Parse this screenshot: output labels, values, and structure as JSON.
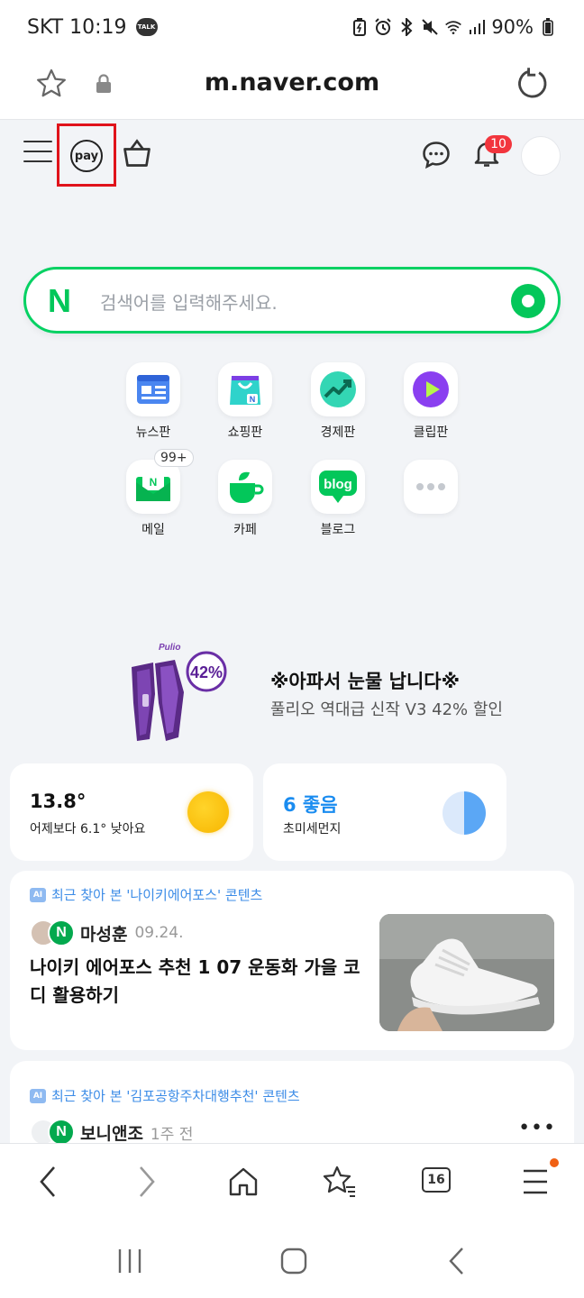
{
  "status_bar": {
    "carrier_time": "SKT 10:19",
    "talk_badge": "TALK",
    "battery": "90%"
  },
  "url_bar": {
    "url": "m.naver.com"
  },
  "header": {
    "pay_label": "pay",
    "notification_count": "10"
  },
  "search": {
    "logo": "N",
    "placeholder": "검색어를 입력해주세요."
  },
  "shortcuts": [
    {
      "label": "뉴스판",
      "icon": "news-icon"
    },
    {
      "label": "쇼핑판",
      "icon": "shopping-icon"
    },
    {
      "label": "경제판",
      "icon": "economy-icon"
    },
    {
      "label": "클립판",
      "icon": "clip-play-icon"
    },
    {
      "label": "메일",
      "icon": "mail-icon",
      "badge": "99+"
    },
    {
      "label": "카페",
      "icon": "cafe-icon"
    },
    {
      "label": "블로그",
      "icon": "blog-icon",
      "icon_text": "blog"
    },
    {
      "label": "",
      "icon": "more-icon"
    }
  ],
  "ad": {
    "brand": "Pulio",
    "discount": "42%",
    "title": "※아파서 눈물 납니다※",
    "subtitle": "풀리오 역대급 신작 V3 42% 할인"
  },
  "weather": {
    "temp": "13.8°",
    "desc": "어제보다 6.1° 낮아요"
  },
  "dust": {
    "value": "6 좋음",
    "label": "초미세먼지"
  },
  "feed": [
    {
      "ai_tag": "AI",
      "context": "최근 찾아 본 '나이키에어포스' 콘텐츠",
      "author": "마성훈",
      "date": "09.24.",
      "headline": "나이키 에어포스 추천 1 07 운동화 가을 코디 활용하기"
    },
    {
      "ai_tag": "AI",
      "context": "최근 찾아 본 '김포공항주차대행추천' 콘텐츠",
      "author": "보니앤조",
      "date": "1주 전"
    }
  ],
  "bottom_nav": {
    "tab_count": "16"
  },
  "colors": {
    "naver_green": "#03c75a",
    "highlight_red": "#e0131b",
    "badge_red": "#f2353d",
    "ai_blue": "#3c8ce7"
  }
}
